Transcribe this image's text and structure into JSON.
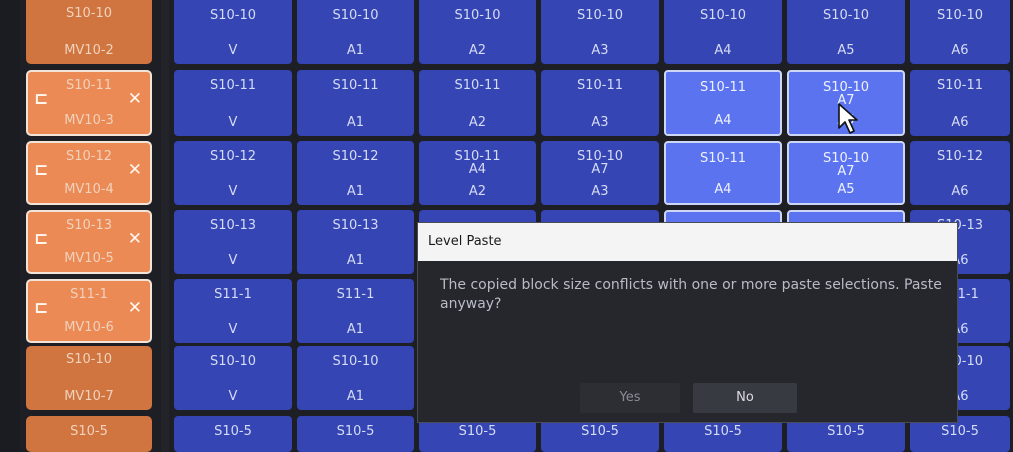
{
  "sources": [
    {
      "top": "S10-10",
      "bottom": "MV10-2",
      "highlighted": false,
      "icons": false
    },
    {
      "top": "S10-11",
      "bottom": "MV10-3",
      "highlighted": true,
      "icons": true
    },
    {
      "top": "S10-12",
      "bottom": "MV10-4",
      "highlighted": true,
      "icons": true
    },
    {
      "top": "S10-13",
      "bottom": "MV10-5",
      "highlighted": true,
      "icons": true
    },
    {
      "top": "S11-1",
      "bottom": "MV10-6",
      "highlighted": true,
      "icons": true
    },
    {
      "top": "S10-10",
      "bottom": "MV10-7",
      "highlighted": false,
      "icons": false
    },
    {
      "top": "S10-5",
      "bottom": "",
      "highlighted": false,
      "icons": false
    }
  ],
  "grid": [
    [
      {
        "top": "S10-10",
        "mid": "",
        "bottom": "V"
      },
      {
        "top": "S10-10",
        "mid": "",
        "bottom": "A1"
      },
      {
        "top": "S10-10",
        "mid": "",
        "bottom": "A2"
      },
      {
        "top": "S10-10",
        "mid": "",
        "bottom": "A3"
      },
      {
        "top": "S10-10",
        "mid": "",
        "bottom": "A4"
      },
      {
        "top": "S10-10",
        "mid": "",
        "bottom": "A5"
      },
      {
        "top": "S10-10",
        "mid": "",
        "bottom": "A6"
      }
    ],
    [
      {
        "top": "S10-11",
        "mid": "",
        "bottom": "V"
      },
      {
        "top": "S10-11",
        "mid": "",
        "bottom": "A1"
      },
      {
        "top": "S10-11",
        "mid": "",
        "bottom": "A2"
      },
      {
        "top": "S10-11",
        "mid": "",
        "bottom": "A3"
      },
      {
        "top": "S10-11",
        "mid": "",
        "bottom": "A4",
        "selected": true
      },
      {
        "top": "S10-10",
        "mid": "A7",
        "bottom": "A5",
        "selected": true
      },
      {
        "top": "S10-11",
        "mid": "",
        "bottom": "A6"
      }
    ],
    [
      {
        "top": "S10-12",
        "mid": "",
        "bottom": "V"
      },
      {
        "top": "S10-12",
        "mid": "",
        "bottom": "A1"
      },
      {
        "top": "S10-11",
        "mid": "A4",
        "bottom": "A2"
      },
      {
        "top": "S10-10",
        "mid": "A7",
        "bottom": "A3"
      },
      {
        "top": "S10-11",
        "mid": "",
        "bottom": "A4",
        "selected": true
      },
      {
        "top": "S10-10",
        "mid": "A7",
        "bottom": "A5",
        "selected": true
      },
      {
        "top": "S10-12",
        "mid": "",
        "bottom": "A6"
      }
    ],
    [
      {
        "top": "S10-13",
        "mid": "",
        "bottom": "V"
      },
      {
        "top": "S10-13",
        "mid": "",
        "bottom": "A1"
      },
      {
        "top": "",
        "mid": "",
        "bottom": ""
      },
      {
        "top": "",
        "mid": "",
        "bottom": ""
      },
      {
        "top": "",
        "mid": "",
        "bottom": "",
        "selected": true
      },
      {
        "top": "",
        "mid": "",
        "bottom": "",
        "selected": true
      },
      {
        "top": "S10-13",
        "mid": "",
        "bottom": "A6"
      }
    ],
    [
      {
        "top": "S11-1",
        "mid": "",
        "bottom": "V"
      },
      {
        "top": "S11-1",
        "mid": "",
        "bottom": "A1"
      },
      {
        "top": "",
        "mid": "",
        "bottom": ""
      },
      {
        "top": "",
        "mid": "",
        "bottom": ""
      },
      {
        "top": "",
        "mid": "",
        "bottom": ""
      },
      {
        "top": "",
        "mid": "",
        "bottom": ""
      },
      {
        "top": "S11-1",
        "mid": "",
        "bottom": "A6"
      }
    ],
    [
      {
        "top": "S10-10",
        "mid": "",
        "bottom": "V"
      },
      {
        "top": "S10-10",
        "mid": "",
        "bottom": "A1"
      },
      {
        "top": "",
        "mid": "",
        "bottom": ""
      },
      {
        "top": "",
        "mid": "",
        "bottom": ""
      },
      {
        "top": "",
        "mid": "",
        "bottom": ""
      },
      {
        "top": "",
        "mid": "",
        "bottom": ""
      },
      {
        "top": "S10-10",
        "mid": "",
        "bottom": "A6"
      }
    ],
    [
      {
        "top": "S10-5",
        "mid": "",
        "bottom": ""
      },
      {
        "top": "S10-5",
        "mid": "",
        "bottom": ""
      },
      {
        "top": "S10-5",
        "mid": "",
        "bottom": ""
      },
      {
        "top": "S10-5",
        "mid": "",
        "bottom": ""
      },
      {
        "top": "S10-5",
        "mid": "",
        "bottom": ""
      },
      {
        "top": "S10-5",
        "mid": "",
        "bottom": ""
      },
      {
        "top": "S10-5",
        "mid": "",
        "bottom": ""
      }
    ]
  ],
  "source_icons": {
    "left": "⊏",
    "right": "✕",
    "left_name": "split-icon",
    "right_name": "crosspoint-icon"
  },
  "dialog": {
    "title": "Level Paste",
    "message": "The copied block size conflicts with one or more paste selections. Paste anyway?",
    "yes_label": "Yes",
    "no_label": "No"
  },
  "colors": {
    "source_orange": "#d07540",
    "source_highlight": "#ec8a55",
    "dest_blue": "#3545b4",
    "dest_selected": "#5b73ee",
    "dialog_bg": "#25272d"
  }
}
